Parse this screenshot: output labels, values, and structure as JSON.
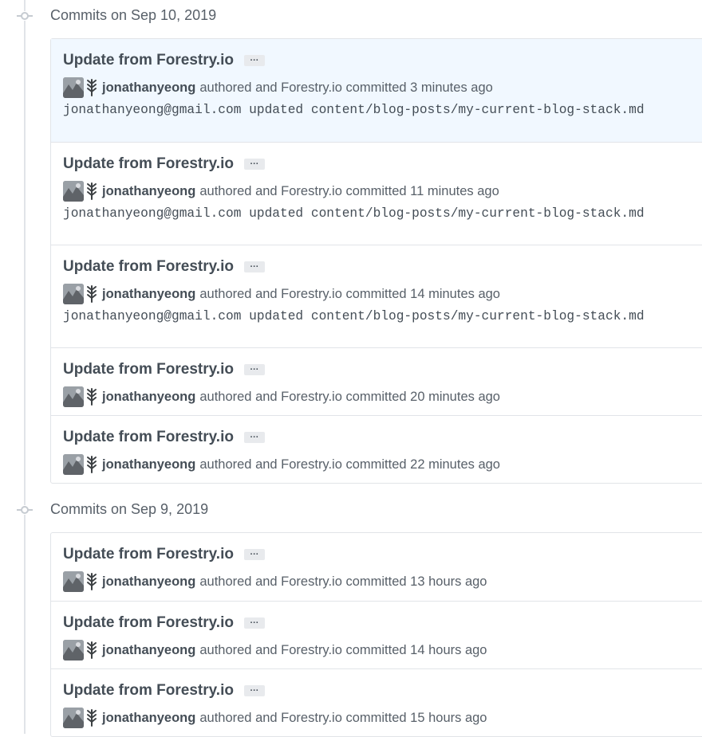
{
  "groups": [
    {
      "title": "Commits on Sep 10, 2019",
      "commits": [
        {
          "title": "Update from Forestry.io",
          "author": "jonathanyeong",
          "meta": "authored and Forestry.io committed 3 minutes ago",
          "description": "jonathanyeong@gmail.com updated content/blog-posts/my-current-blog-stack.md",
          "highlighted": true
        },
        {
          "title": "Update from Forestry.io",
          "author": "jonathanyeong",
          "meta": "authored and Forestry.io committed 11 minutes ago",
          "description": "jonathanyeong@gmail.com updated content/blog-posts/my-current-blog-stack.md"
        },
        {
          "title": "Update from Forestry.io",
          "author": "jonathanyeong",
          "meta": "authored and Forestry.io committed 14 minutes ago",
          "description": "jonathanyeong@gmail.com updated content/blog-posts/my-current-blog-stack.md"
        },
        {
          "title": "Update from Forestry.io",
          "author": "jonathanyeong",
          "meta": "authored and Forestry.io committed 20 minutes ago"
        },
        {
          "title": "Update from Forestry.io",
          "author": "jonathanyeong",
          "meta": "authored and Forestry.io committed 22 minutes ago"
        }
      ]
    },
    {
      "title": "Commits on Sep 9, 2019",
      "commits": [
        {
          "title": "Update from Forestry.io",
          "author": "jonathanyeong",
          "meta": "authored and Forestry.io committed 13 hours ago"
        },
        {
          "title": "Update from Forestry.io",
          "author": "jonathanyeong",
          "meta": "authored and Forestry.io committed 14 hours ago"
        },
        {
          "title": "Update from Forestry.io",
          "author": "jonathanyeong",
          "meta": "authored and Forestry.io committed 15 hours ago"
        }
      ]
    }
  ],
  "ellipsis_label": "···",
  "colors": {
    "highlight": "#f1f8ff",
    "border": "#e1e4e8",
    "muted": "#586069"
  }
}
